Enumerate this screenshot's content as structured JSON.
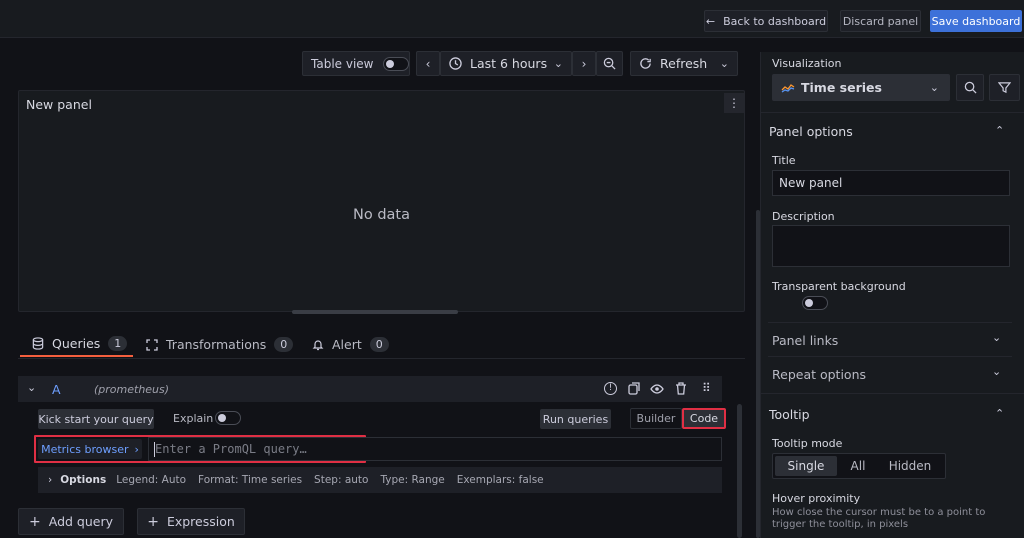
{
  "topbar": {
    "back_label": "Back to dashboard",
    "discard_label": "Discard panel",
    "save_label": "Save dashboard"
  },
  "toolbar": {
    "table_view_label": "Table view",
    "time_range": "Last 6 hours",
    "refresh_label": "Refresh"
  },
  "panel": {
    "title": "New panel",
    "empty_text": "No data"
  },
  "tabs": [
    {
      "label": "Queries",
      "count": "1"
    },
    {
      "label": "Transformations",
      "count": "0"
    },
    {
      "label": "Alert",
      "count": "0"
    }
  ],
  "query": {
    "ref_id": "A",
    "datasource": "(prometheus)",
    "kick_start_label": "Kick start your query",
    "explain_label": "Explain",
    "run_queries_label": "Run queries",
    "builder_label": "Builder",
    "code_label": "Code",
    "metrics_browser_label": "Metrics browser",
    "query_placeholder": "Enter a PromQL query…",
    "options_label": "Options",
    "options_summary": [
      "Legend: Auto",
      "Format: Time series",
      "Step: auto",
      "Type: Range",
      "Exemplars: false"
    ]
  },
  "bottom_buttons": {
    "add_query_label": "Add query",
    "expression_label": "Expression"
  },
  "sidebar": {
    "visualization_label": "Visualization",
    "visualization_value": "Time series",
    "panel_options_title": "Panel options",
    "title_label": "Title",
    "title_value": "New panel",
    "description_label": "Description",
    "transparent_label": "Transparent background",
    "panel_links_label": "Panel links",
    "repeat_options_label": "Repeat options",
    "tooltip_title": "Tooltip",
    "tooltip_mode_label": "Tooltip mode",
    "tooltip_modes": [
      "Single",
      "All",
      "Hidden"
    ],
    "hover_proximity_label": "Hover proximity",
    "hover_proximity_desc": "How close the cursor must be to a point to trigger the tooltip, in pixels"
  },
  "colors": {
    "primary": "#3d71d9",
    "highlight_red": "#e02f44",
    "link_blue": "#6e9fff"
  }
}
